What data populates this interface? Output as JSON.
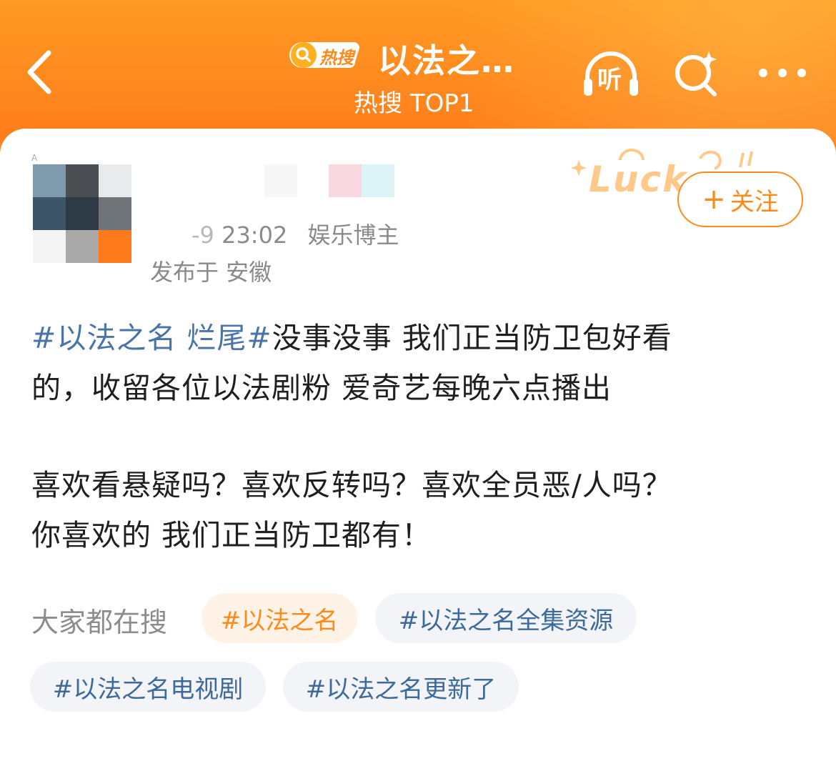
{
  "header": {
    "back_icon": "chevron-left-icon",
    "badge_label": "热搜",
    "badge_icon": "search-icon",
    "title": "以法之…",
    "subtitle": "热搜 TOP1",
    "listen_label": "听",
    "listen_icon": "headphones-icon",
    "search_icon": "sparkle-search-icon",
    "more_icon": "more-dots-icon"
  },
  "post": {
    "timestamp": "23:02",
    "timestamp_prefix_visible": "-9",
    "author_tag": "娱乐博主",
    "location": "发布于 安徽",
    "follow_label": "关注",
    "decoration_text": "Luck",
    "body": {
      "hashtag": "#以法之名 烂尾#",
      "line1_rest": "没事没事 我们正当防卫包好看",
      "line2": "的，收留各位以法剧粉 爱奇艺每晚六点播出",
      "line3": "喜欢看悬疑吗？喜欢反转吗？喜欢全员恶/人吗？",
      "line4": "你喜欢的 我们正当防卫都有！"
    }
  },
  "related_search": {
    "label": "大家都在搜",
    "chips": [
      "#以法之名",
      "#以法之名全集资源",
      "#以法之名电视剧",
      "#以法之名更新了"
    ]
  },
  "colors": {
    "accent": "#ff8a1c",
    "link": "#4a74a8",
    "text": "#1f1f1f",
    "muted": "#8a8a8a"
  }
}
